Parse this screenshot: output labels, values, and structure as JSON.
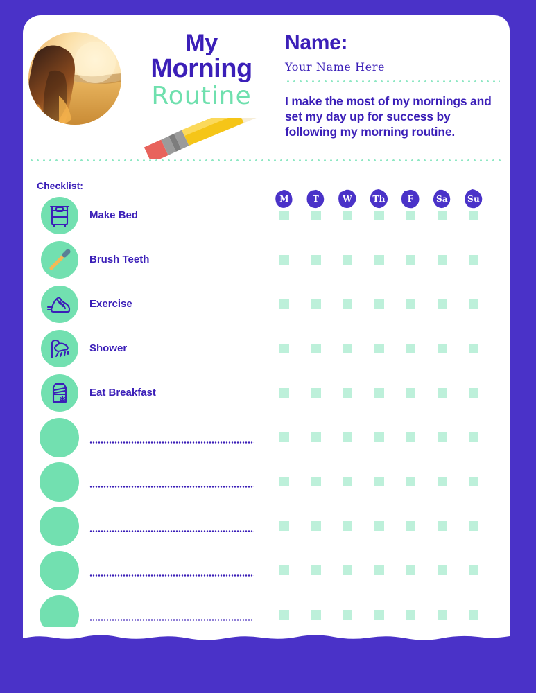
{
  "theme": {
    "background_purple": "#4a32c8",
    "paper_white": "#ffffff",
    "ink_purple": "#3b1fb8",
    "mint": "#72e0b0",
    "mint_light": "#bdf0da",
    "pencil_yellow": "#f5c518"
  },
  "header": {
    "title_line1": "My",
    "title_line2": "Morning",
    "title_line3": "Routine",
    "photo_alt": "girl-in-field-at-sunset",
    "pencil_alt": "pencil-illustration",
    "name_label": "Name:",
    "name_value": "Your Name Here",
    "affirmation": "I make the most of my mornings and set my day up for success by following my morning routine."
  },
  "checklist": {
    "label": "Checklist:",
    "days": [
      "M",
      "T",
      "W",
      "Th",
      "F",
      "Sa",
      "Su"
    ],
    "items": [
      {
        "label": "Make Bed",
        "icon": "bed-icon"
      },
      {
        "label": "Brush Teeth",
        "icon": "toothbrush-icon"
      },
      {
        "label": "Exercise",
        "icon": "sneaker-icon"
      },
      {
        "label": "Shower",
        "icon": "shower-icon"
      },
      {
        "label": "Eat Breakfast",
        "icon": "cereal-box-icon"
      },
      {
        "label": "",
        "icon": "blank-icon"
      },
      {
        "label": "",
        "icon": "blank-icon"
      },
      {
        "label": "",
        "icon": "blank-icon"
      },
      {
        "label": "",
        "icon": "blank-icon"
      },
      {
        "label": "",
        "icon": "blank-icon"
      }
    ]
  }
}
